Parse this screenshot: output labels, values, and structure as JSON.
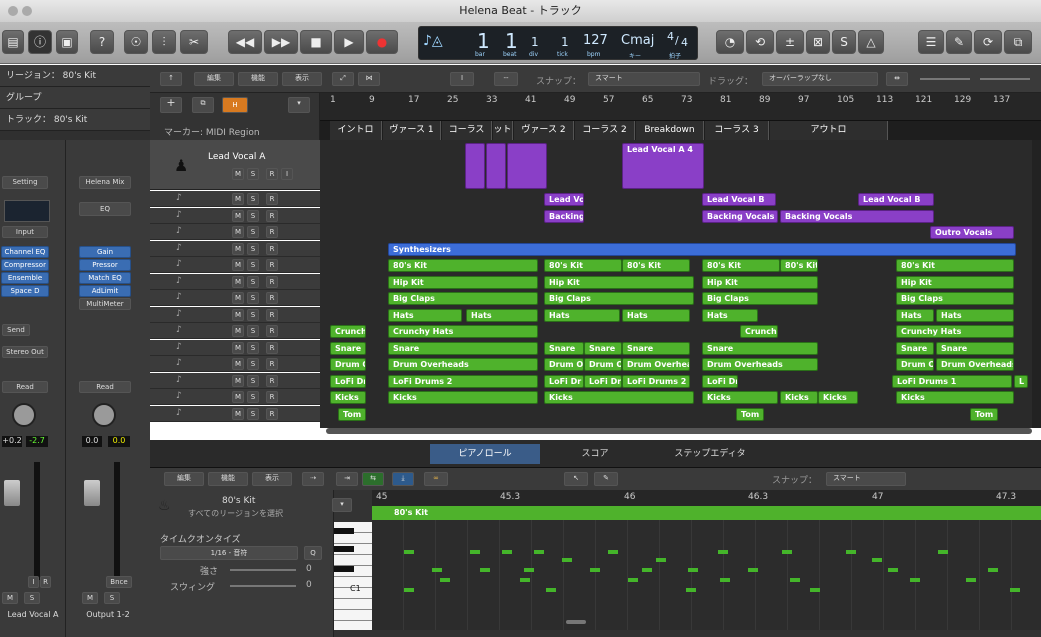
{
  "window": {
    "title": "Helena Beat - トラック"
  },
  "lcd": {
    "bar": "1",
    "beat": "1",
    "div": "1",
    "tick": "1",
    "bpm": "127",
    "key": "Cmaj",
    "sig_top": "4",
    "sig_bottom": "4",
    "lbl_bar": "bar",
    "lbl_beat": "beat",
    "lbl_div": "div",
    "lbl_tick": "tick",
    "lbl_bpm": "bpm",
    "lbl_key": "キー",
    "lbl_sig": "拍子"
  },
  "inspector": {
    "region": "リージョン： 80's Kit",
    "group": "グループ",
    "track": "トラック： 80's Kit",
    "strip1": {
      "setting": "Setting",
      "input": "Input",
      "plugins": [
        "Channel EQ",
        "Compressor",
        "Ensemble",
        "Space D"
      ],
      "send": "Send",
      "out": "Stereo Out",
      "read": "Read",
      "v1": "+0.2",
      "v2": "-2.7",
      "name": "Lead Vocal A",
      "m": "M",
      "s": "S",
      "i": "I",
      "r": "R"
    },
    "strip2": {
      "setting": "Helena Mix",
      "eq": "EQ",
      "plugins": [
        "Gain",
        "Pressor",
        "Match EQ",
        "AdLimit",
        "MultiMeter"
      ],
      "read": "Read",
      "v1": "0.0",
      "v2": "0.0",
      "bnce": "Bnce",
      "name": "Output 1-2",
      "m": "M",
      "s": "S"
    }
  },
  "menubar": {
    "edit": "編集",
    "func": "機能",
    "view": "表示",
    "snap_label": "スナップ：",
    "snap": "スマート",
    "drag_label": "ドラッグ：",
    "drag": "オーバーラップなし"
  },
  "tracklist": {
    "marker_label": "マーカー: MIDI Region",
    "h": "H",
    "first_track": "Lead Vocal A"
  },
  "ruler": [
    "1",
    "9",
    "17",
    "25",
    "33",
    "41",
    "49",
    "57",
    "65",
    "73",
    "81",
    "89",
    "97",
    "105",
    "113",
    "121",
    "129",
    "137"
  ],
  "markers": [
    "イントロ",
    "ヴァース 1",
    "コーラス",
    "ット",
    "ヴァース 2",
    "コーラス 2",
    "Breakdown",
    "コーラス 3",
    "アウトロ"
  ],
  "regions": {
    "lead_vocal_a4": "Lead Vocal A 4",
    "lead_vo": "Lead Vo",
    "backing": "Backing",
    "lead_vocal_b": "Lead Vocal B",
    "backing_vocals": "Backing Vocals",
    "outro_vocals": "Outro Vocals",
    "synth": "Synthesizers",
    "kit": "80's Kit",
    "hip": "Hip Kit",
    "claps": "Big Claps",
    "hats": "Hats",
    "crunch": "Crunch",
    "crunchy": "Crunchy Hats",
    "snare": "Snare",
    "drum_o": "Drum O",
    "drum_oh": "Drum Overheads",
    "drum_ovh": "Drum Overhea",
    "lofi": "LoFi Drums 2",
    "lofi_dru": "LoFi Dru",
    "lofi_dr": "LoFi Dr",
    "lofi1": "LoFi Drums 1",
    "kicks": "Kicks",
    "tom": "Tom",
    "l": "L"
  },
  "editor": {
    "tabs": [
      "ピアノロール",
      "スコア",
      "ステップエディタ"
    ],
    "region_name": "80's Kit",
    "region_sub": "すべてのリージョンを選択",
    "quantize": "タイムクオンタイズ",
    "qvalue": "1/16 - 音符",
    "q": "Q",
    "strength": "強さ",
    "swing": "スウィング",
    "zero": "0",
    "snap": "スマート",
    "snap_label": "スナップ：",
    "ruler": [
      "45",
      "45.3",
      "46",
      "46.3",
      "47",
      "47.3"
    ],
    "c1": "C1"
  }
}
